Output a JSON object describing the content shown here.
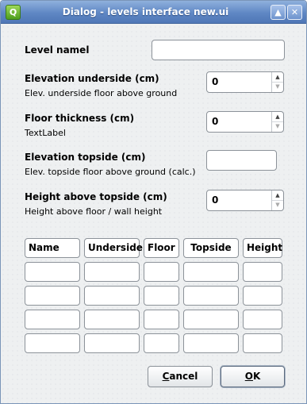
{
  "window": {
    "title": "Dialog - levels interface new.ui"
  },
  "form": {
    "level_name": {
      "label": "Level namel",
      "value": ""
    },
    "elevation_underside": {
      "label": "Elevation underside (cm)",
      "sublabel": "Elev. underside floor above ground",
      "value": "0"
    },
    "floor_thickness": {
      "label": "Floor thickness (cm)",
      "sublabel": "TextLabel",
      "value": "0"
    },
    "elevation_topside": {
      "label": "Elevation topside (cm)",
      "sublabel": "Elev. topside floor above ground (calc.)",
      "value": ""
    },
    "height_above_topside": {
      "label": "Height above topside (cm)",
      "sublabel": "Height above floor / wall height",
      "value": "0"
    }
  },
  "table": {
    "headers": [
      "Name",
      "Underside",
      "Floor",
      "Topside",
      "Height"
    ],
    "rows": [
      [
        "",
        "",
        "",
        "",
        ""
      ],
      [
        "",
        "",
        "",
        "",
        ""
      ],
      [
        "",
        "",
        "",
        "",
        ""
      ],
      [
        "",
        "",
        "",
        "",
        ""
      ]
    ]
  },
  "buttons": {
    "cancel": "Cancel",
    "ok": "OK"
  },
  "icons": {
    "app": "qt-logo-icon",
    "minimize": "chevron-up-icon",
    "close": "close-icon"
  }
}
